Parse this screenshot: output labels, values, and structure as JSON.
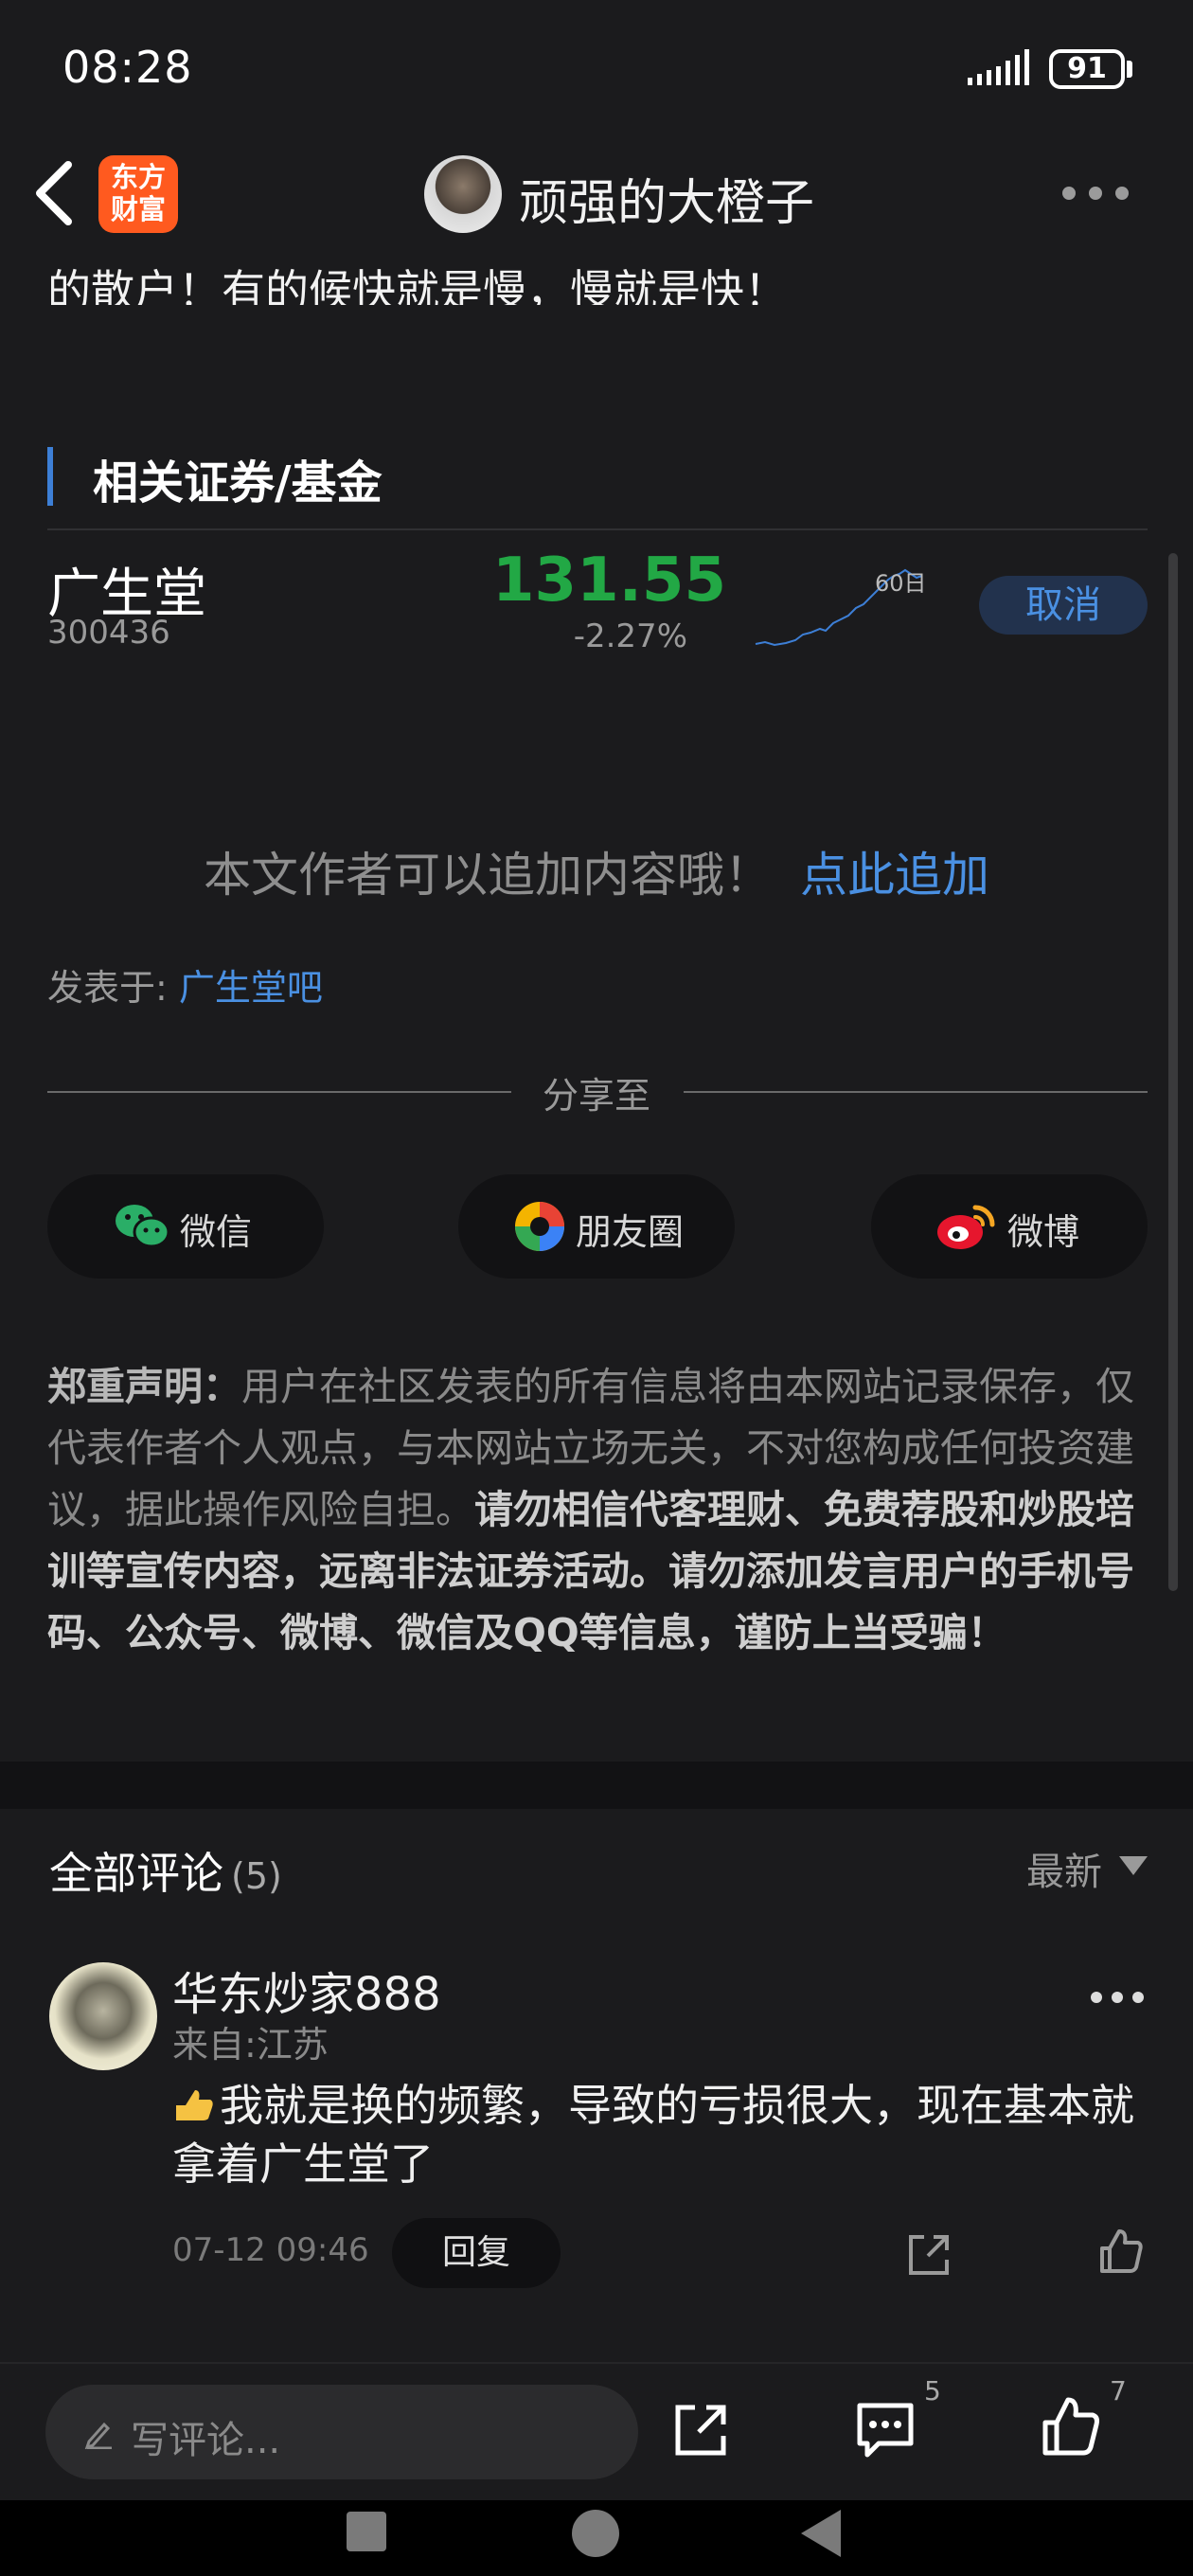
{
  "status_bar": {
    "time": "08:28",
    "battery": "91"
  },
  "nav": {
    "logo_text": "东方财富",
    "title": "顽强的大橙子"
  },
  "article": {
    "cut_text": "的散户！有的候快就是慢，慢就是快！"
  },
  "related": {
    "title": "相关证券/基金",
    "stock": {
      "name": "广生堂",
      "code": "300436",
      "price": "131.55",
      "change": "-2.27%",
      "chart_label": "60日",
      "action": "取消"
    }
  },
  "add_content": {
    "text": "本文作者可以追加内容哦！",
    "link": "点此追加"
  },
  "posted": {
    "label": "发表于: ",
    "link": "广生堂吧"
  },
  "share": {
    "title": "分享至",
    "buttons": [
      {
        "label": "微信",
        "icon": "wechat-icon"
      },
      {
        "label": "朋友圈",
        "icon": "moments-icon"
      },
      {
        "label": "微博",
        "icon": "weibo-icon"
      }
    ]
  },
  "disclaimer": {
    "head": "郑重声明",
    "sep": "：",
    "normal": "用户在社区发表的所有信息将由本网站记录保存，仅代表作者个人观点，与本网站立场无关，不对您构成任何投资建议，据此操作风险自担。",
    "strong": "请勿相信代客理财、免费荐股和炒股培训等宣传内容，远离非法证券活动。请勿添加发言用户的手机号码、公众号、微博、微信及QQ等信息，谨防上当受骗！"
  },
  "comments": {
    "title": "全部评论",
    "count": "(5)",
    "sort": "最新",
    "items": [
      {
        "user": "华东炒家888",
        "location": "来自:江苏",
        "text": "我就是换的频繁，导致的亏损很大，现在基本就拿着广生堂了",
        "time": "07-12 09:46",
        "reply": "回复"
      }
    ]
  },
  "bottom_bar": {
    "placeholder": "写评论...",
    "comment_count": "5",
    "like_count": "7"
  },
  "colors": {
    "accent_blue": "#4a90e2",
    "price_green": "#22a845",
    "brand_orange": "#ff5a1f"
  }
}
